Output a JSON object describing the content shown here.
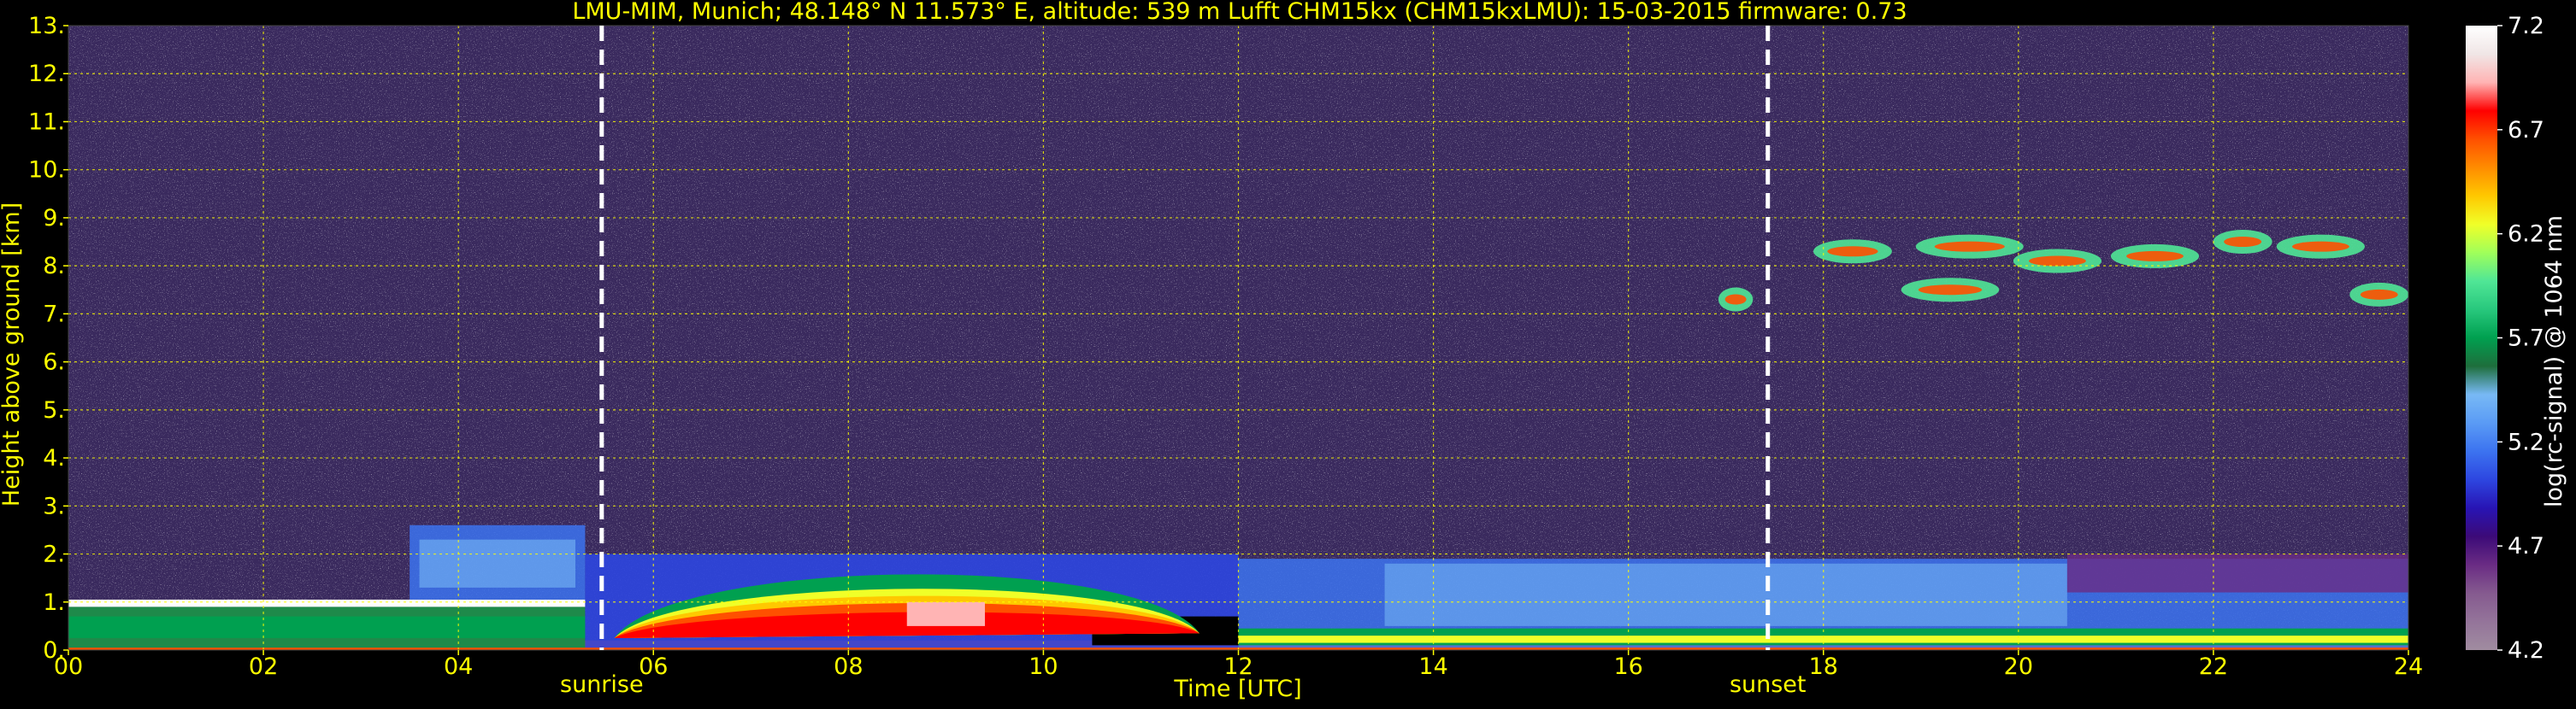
{
  "chart_data": {
    "type": "heatmap",
    "title": "LMU-MIM, Munich; 48.148° N 11.573° E, altitude: 539 m    Lufft CHM15kx (CHM15kxLMU): 15-03-2015    firmware: 0.73",
    "xlabel": "Time [UTC]",
    "ylabel": "Height above ground [km]",
    "xlim": [
      0,
      24
    ],
    "ylim": [
      0,
      13
    ],
    "x_ticks": [
      "00",
      "02",
      "04",
      "06",
      "08",
      "10",
      "12",
      "14",
      "16",
      "18",
      "20",
      "22",
      "24"
    ],
    "x_tick_values": [
      0,
      2,
      4,
      6,
      8,
      10,
      12,
      14,
      16,
      18,
      20,
      22,
      24
    ],
    "y_ticks": [
      "0.",
      "1.",
      "2.",
      "3.",
      "4.",
      "5.",
      "6.",
      "7.",
      "8.",
      "9.",
      "10.",
      "11.",
      "12.",
      "13."
    ],
    "y_tick_values": [
      0,
      1,
      2,
      3,
      4,
      5,
      6,
      7,
      8,
      9,
      10,
      11,
      12,
      13
    ],
    "grid": true,
    "colorbar": {
      "label": "log(rc-signal) @ 1064 nm",
      "range": [
        4.2,
        7.2
      ],
      "ticks": [
        "4.2",
        "4.7",
        "5.2",
        "5.7",
        "6.2",
        "6.7",
        "7.2"
      ],
      "tick_values": [
        4.2,
        4.7,
        5.2,
        5.7,
        6.2,
        6.7,
        7.2
      ],
      "colors": [
        "#a08ca0",
        "#94749a",
        "#855a8f",
        "#6a2c84",
        "#3c0a78",
        "#2814b4",
        "#2d46e0",
        "#3c73f0",
        "#5a9bf5",
        "#78b9f5",
        "#1e6e3c",
        "#00a050",
        "#28c87d",
        "#50e696",
        "#a0ff5a",
        "#f0ff28",
        "#ffc800",
        "#ff8c00",
        "#ff5000",
        "#ff0000",
        "#ffb4b4",
        "#f0e6e6",
        "#ffffff"
      ]
    },
    "markers": [
      {
        "label": "sunrise",
        "x": 5.47
      },
      {
        "label": "sunset",
        "x": 17.43
      }
    ],
    "features": [
      {
        "name": "boundary layer / residual layer",
        "x_range": [
          0,
          24
        ],
        "height_range_km": [
          0,
          2.1
        ]
      },
      {
        "name": "cirrus cloud",
        "x_range": [
          17.1,
          24
        ],
        "height_range_km": [
          6.8,
          8.8
        ]
      }
    ]
  },
  "colors": {
    "text": "#ffff00",
    "grid": "#ffff00",
    "background": "#000000",
    "noise": "#3a2a5e",
    "marker": "#ffffff"
  }
}
